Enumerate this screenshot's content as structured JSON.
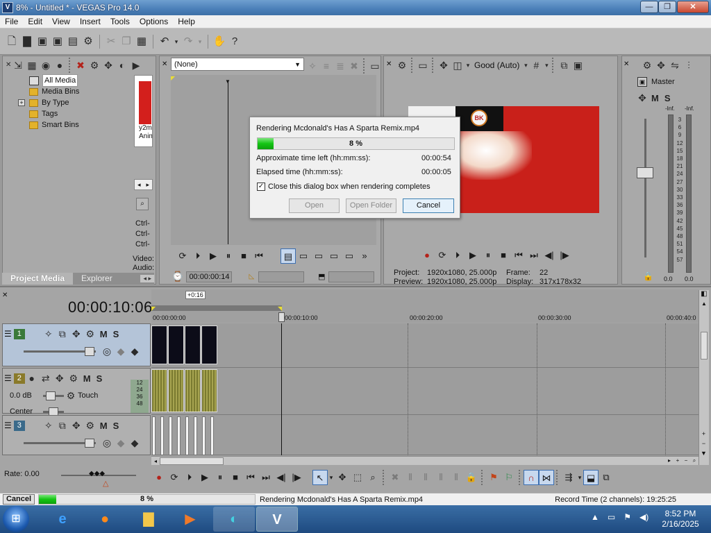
{
  "window": {
    "title": "8% - Untitled * - VEGAS Pro 14.0",
    "logo": "V",
    "buttons": {
      "minimize": "—",
      "maximize": "❐",
      "close": "✕"
    }
  },
  "menu": [
    "File",
    "Edit",
    "View",
    "Insert",
    "Tools",
    "Options",
    "Help"
  ],
  "project_media": {
    "items": [
      "All Media",
      "Media Bins",
      "By Type",
      "Tags",
      "Smart Bins"
    ],
    "expand_sign": "+",
    "thumb_label_1": "y2m",
    "thumb_label_2": "Anim",
    "tabs": [
      "Project Media",
      "Explorer"
    ],
    "side_labels": [
      "Ctrl-",
      "Ctrl-",
      "Ctrl-"
    ],
    "meta_labels": [
      "Video:",
      "Audio:"
    ]
  },
  "trimmer": {
    "fx_select": "(None)",
    "timecode": "00:00:00:14"
  },
  "video_preview": {
    "quality": "Good (Auto)",
    "project_label": "Project:",
    "project_value": "1920x1080, 25.000p",
    "preview_label": "Preview:",
    "preview_value": "1920x1080, 25.000p",
    "frame_label": "Frame:",
    "frame_value": "22",
    "display_label": "Display:",
    "display_value": "317x178x32"
  },
  "master": {
    "title": "Master",
    "ms": [
      "M",
      "S"
    ],
    "inf_left": "-Inf.",
    "inf_right": "-Inf.",
    "scale": [
      "3",
      "6",
      "9",
      "12",
      "15",
      "18",
      "21",
      "24",
      "27",
      "30",
      "33",
      "36",
      "39",
      "42",
      "45",
      "48",
      "51",
      "54",
      "57"
    ],
    "bottom_left": "0.0",
    "bottom_right": "0.0"
  },
  "render_dialog": {
    "title": "Rendering Mcdonald's Has A Sparta Remix.mp4",
    "progress_label": "8 %",
    "progress": 0.08,
    "time_left_label": "Approximate time left (hh:mm:ss):",
    "time_left_value": "00:00:54",
    "elapsed_label": "Elapsed time (hh:mm:ss):",
    "elapsed_value": "00:00:05",
    "close_checkbox_label": "Close this dialog box when rendering completes",
    "close_checked": true,
    "buttons": {
      "open": "Open",
      "open_folder": "Open Folder",
      "cancel": "Cancel"
    }
  },
  "timeline": {
    "timecode": "00:00:10:06",
    "offset_badge": "+0:16",
    "ruler": [
      "00:00:00:00",
      "00:00:10:00",
      "00:00:20:00",
      "00:00:30:00",
      "00:00:40:0"
    ],
    "tracks": [
      {
        "num": "1",
        "type": "video"
      },
      {
        "num": "2",
        "type": "audio",
        "volume": "0.0 dB",
        "pan": "Center",
        "mode": "Touch",
        "meter_scale": [
          "12",
          "24",
          "36",
          "48"
        ]
      },
      {
        "num": "3",
        "type": "video"
      }
    ],
    "rate": "Rate: 0.00"
  },
  "status_bar": {
    "cancel": "Cancel",
    "progress_label": "8 %",
    "progress": 0.08,
    "render_text": "Rendering Mcdonald's Has A Sparta Remix.mp4",
    "record_time": "Record Time (2 channels): 19:25:25"
  },
  "taskbar": {
    "time": "8:52 PM",
    "date": "2/16/2025"
  },
  "colors": {
    "accent_green": "#14c514",
    "video_bg": "#c9201a",
    "taskbar": "#1e4a80"
  }
}
